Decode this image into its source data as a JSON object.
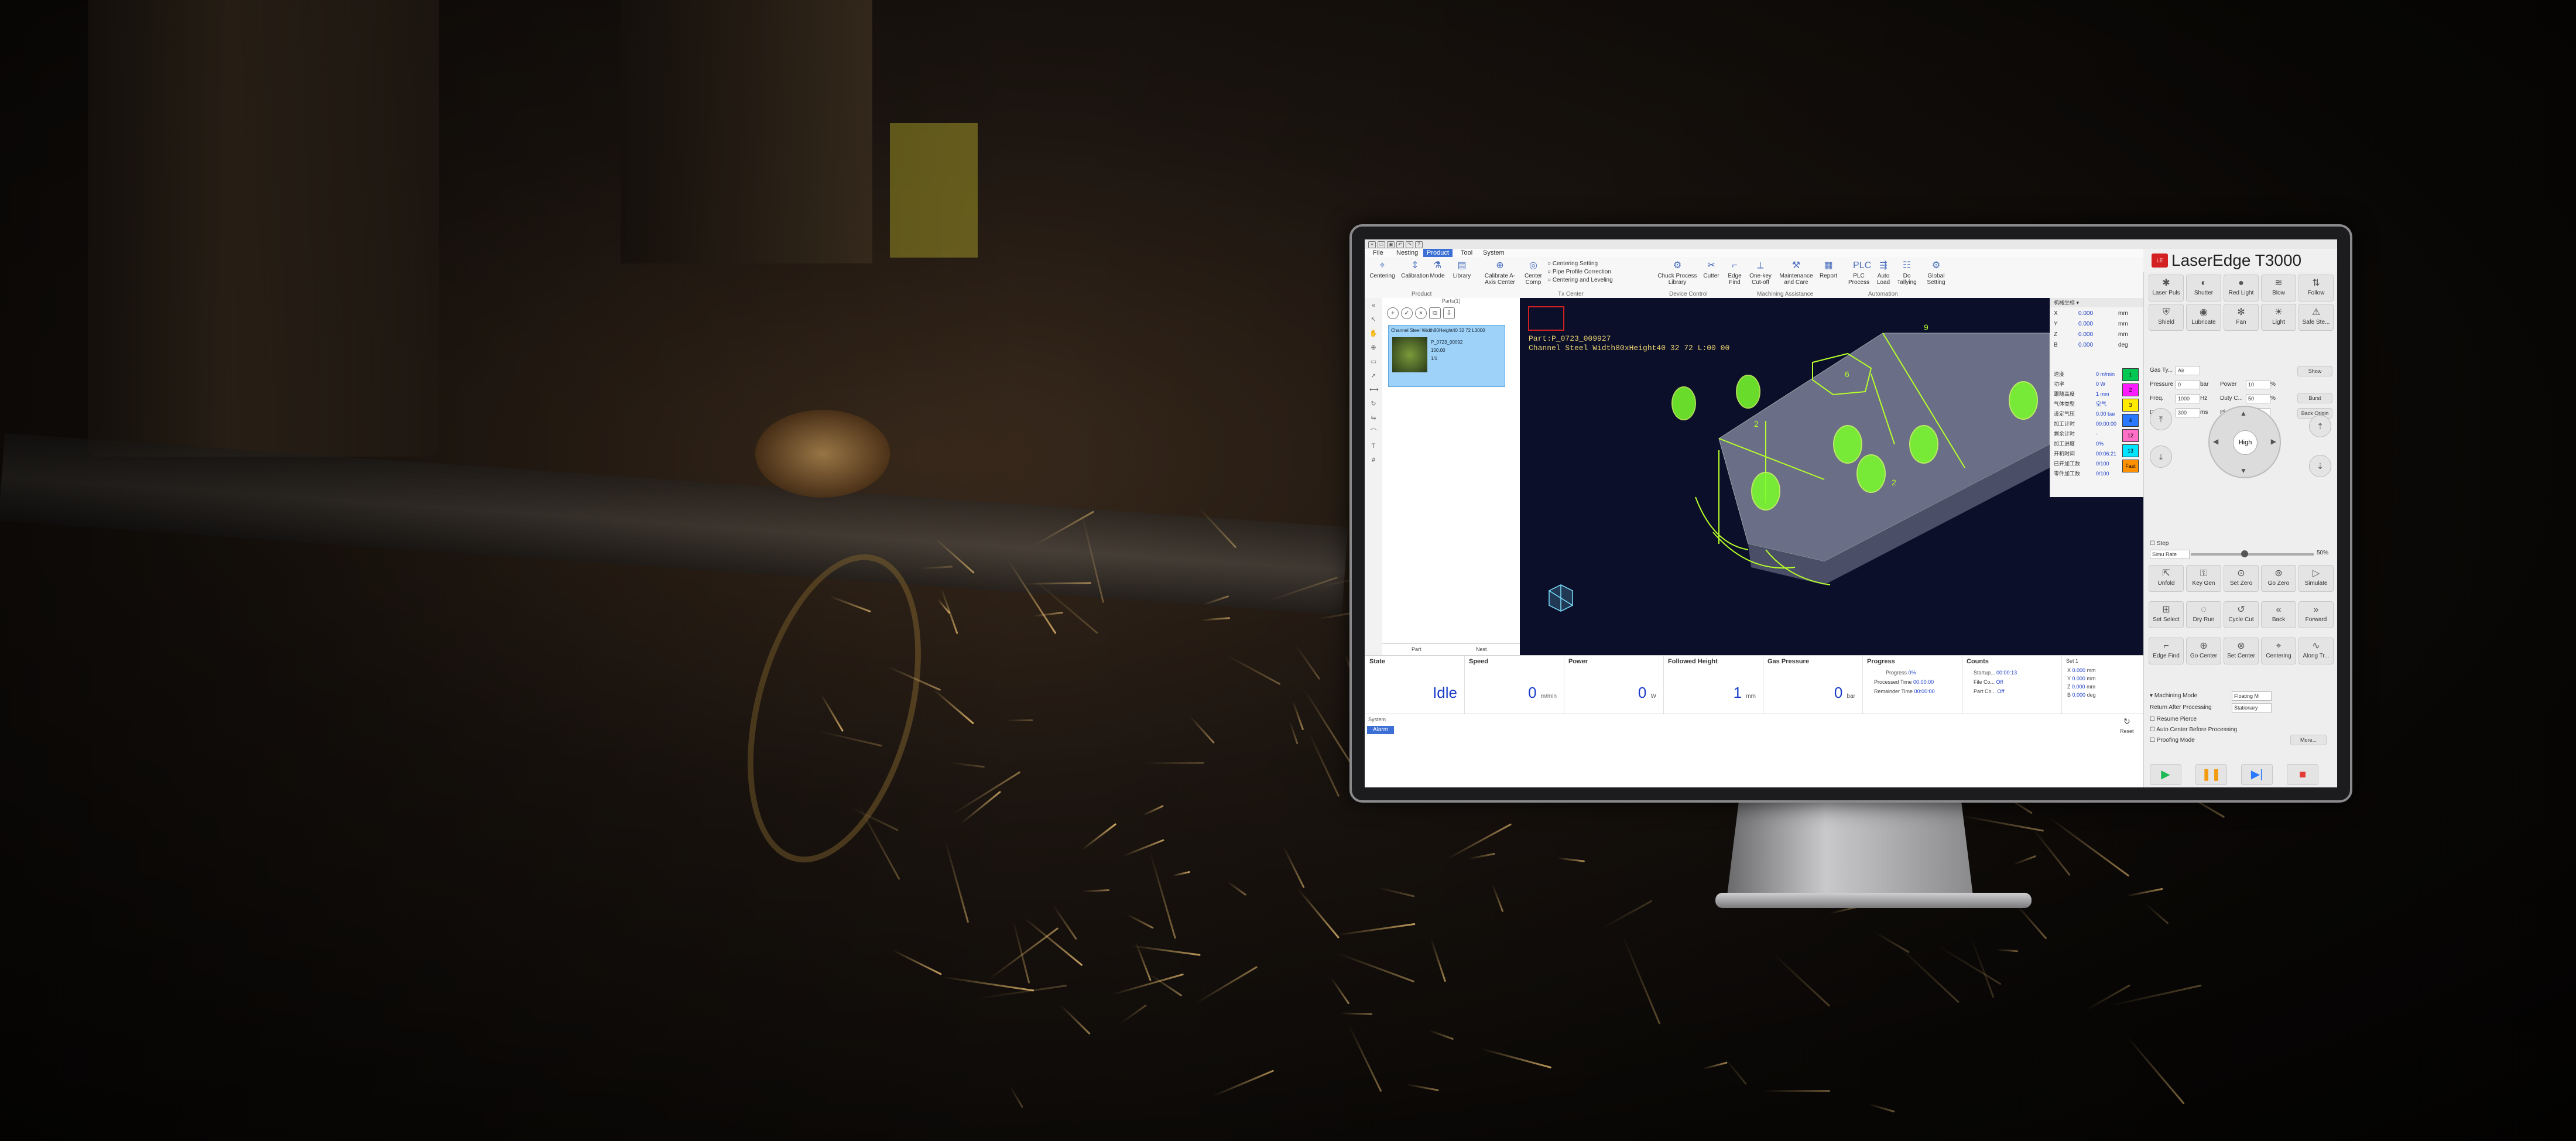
{
  "app": {
    "brand": "LaserEdge T3000",
    "logo_text": "LE"
  },
  "menu": {
    "tabs": [
      {
        "label": "File"
      },
      {
        "label": "Nesting"
      },
      {
        "label": "Product"
      },
      {
        "label": "Tool"
      },
      {
        "label": "System"
      }
    ],
    "active": "Product"
  },
  "ribbon": {
    "buttons": [
      {
        "label": "Centering",
        "icon": "crosshair-icon"
      },
      {
        "label": "Calibration",
        "icon": "calibration-icon"
      },
      {
        "label": "Mode",
        "icon": "mode-icon"
      },
      {
        "label": "Library",
        "icon": "library-icon"
      },
      {
        "label": "Calibrate A-Axis Center",
        "icon": "calibrate-icon"
      },
      {
        "label": "Center Comp",
        "icon": "center-comp-icon"
      },
      {
        "label": "Chuck Process Library",
        "icon": "chuck-icon"
      },
      {
        "label": "Cutter",
        "icon": "cutter-icon"
      },
      {
        "label": "Edge Find",
        "icon": "edge-find-icon"
      },
      {
        "label": "One-key Cut-off",
        "icon": "cutoff-icon"
      },
      {
        "label": "Maintenance and Care",
        "icon": "maintenance-icon"
      },
      {
        "label": "Report",
        "icon": "report-icon"
      },
      {
        "label": "PLC Process",
        "icon": "plc-icon"
      },
      {
        "label": "Auto Load",
        "icon": "auto-load-icon"
      },
      {
        "label": "Do Tallying",
        "icon": "tally-icon"
      },
      {
        "label": "Global Setting",
        "icon": "gear-icon"
      }
    ],
    "small_items": [
      "Centering Setting",
      "Pipe Profile Correction",
      "Centering and Leveling"
    ],
    "groups": [
      "Product",
      "Tx Center",
      "Device Control",
      "Machining Assistance",
      "Automation"
    ]
  },
  "parts_panel": {
    "title": "Parts(1)",
    "card_name": "Channel Steel Width80Height40 32 72 L3000",
    "card_lines": [
      "P_0723_00092",
      "100.00",
      "1/1"
    ],
    "footer_left": "Part",
    "footer_right": "Nest"
  },
  "canvas": {
    "part_line": "Part:P_0723_009927",
    "desc_line": "Channel Steel Width80xHeight40 32 72 L:00 00",
    "labels": [
      "2",
      "6",
      "9",
      "2"
    ]
  },
  "coords": {
    "header": "机械坐标",
    "rows": [
      {
        "axis": "X",
        "value": "0.000",
        "unit": "mm"
      },
      {
        "axis": "Y",
        "value": "0.000",
        "unit": "mm"
      },
      {
        "axis": "Z",
        "value": "0.000",
        "unit": "mm"
      },
      {
        "axis": "B",
        "value": "0.000",
        "unit": "deg"
      }
    ],
    "params": [
      {
        "label": "速度",
        "value": "0 m/min"
      },
      {
        "label": "功率",
        "value": "0 W"
      },
      {
        "label": "跟随高度",
        "value": "1 mm"
      },
      {
        "label": "气体类型",
        "value": "空气"
      },
      {
        "label": "设定气压",
        "value": "0.00 bar"
      },
      {
        "label": "加工计时",
        "value": "00:00:00"
      },
      {
        "label": "剩余计时",
        "value": "-"
      },
      {
        "label": "加工进度",
        "value": "0%"
      },
      {
        "label": "开机时间",
        "value": "00:06:21"
      },
      {
        "label": "已开加工数",
        "value": "0/100"
      },
      {
        "label": "零件加工数",
        "value": "0/100"
      }
    ]
  },
  "layers": [
    {
      "label": "1",
      "color": "#00c853"
    },
    {
      "label": "2",
      "color": "#ff1cff"
    },
    {
      "label": "3",
      "color": "#ffea00"
    },
    {
      "label": "4",
      "color": "#2979ff"
    },
    {
      "label": "12",
      "color": "#ff6ec7"
    },
    {
      "label": "13",
      "color": "#00e5ff"
    },
    {
      "label": "Fast",
      "color": "#ff9100"
    }
  ],
  "status": {
    "state_label": "State",
    "state_value": "Idle",
    "speed_label": "Speed",
    "speed_value": "0",
    "speed_unit": "m/min",
    "power_label": "Power",
    "power_value": "0",
    "power_unit": "W",
    "follow_label": "Followed Height",
    "follow_value": "1",
    "follow_unit": "mm",
    "gas_label": "Gas Pressure",
    "gas_value": "0",
    "gas_unit": "bar",
    "progress_label": "Progress",
    "progress_rows": [
      {
        "k": "Progress",
        "v": "0%"
      },
      {
        "k": "Processed Time",
        "v": "00:00:00"
      },
      {
        "k": "Remainder Time",
        "v": "00:00:00"
      }
    ],
    "counts_label": "Counts",
    "counts_rows": [
      {
        "k": "Startup...",
        "v": "00:00:13"
      },
      {
        "k": "File Co...",
        "v": "Off"
      },
      {
        "k": "Part Co...",
        "v": "Off"
      }
    ],
    "axes_label": "Set 1",
    "axes_rows": [
      {
        "axis": "X",
        "value": "0.000",
        "unit": "mm"
      },
      {
        "axis": "Y",
        "value": "0.000",
        "unit": "mm"
      },
      {
        "axis": "Z",
        "value": "0.000",
        "unit": "mm"
      },
      {
        "axis": "B",
        "value": "0.000",
        "unit": "deg"
      }
    ],
    "reset_label": "Reset"
  },
  "syslog": {
    "tab_system": "System",
    "tab_alarm": "Alarm"
  },
  "right_panel": {
    "top_buttons": [
      "Laser Puls",
      "Shutter",
      "Red Light",
      "Blow",
      "Follow",
      "Shield",
      "Lubricate",
      "Fan",
      "Light",
      "Safe Ste..."
    ],
    "fields": [
      {
        "label": "Gas Ty...",
        "value": "Air"
      },
      {
        "label": "Pressure",
        "value": "0",
        "unit": "bar"
      },
      {
        "label": "Power",
        "value": "10",
        "unit": "%"
      },
      {
        "label": "Freq.",
        "value": "1000",
        "unit": "Hz"
      },
      {
        "label": "Duty C...",
        "value": "50",
        "unit": "%"
      },
      {
        "label": "Delay",
        "value": "300",
        "unit": "ms"
      },
      {
        "label": "Pierce",
        "value": "",
        "unit": ""
      }
    ],
    "side_buttons": [
      "Show",
      "Burst",
      "Back Origin"
    ],
    "dpad_center": "High",
    "step_label": "Step",
    "step_mode": "Simu Rate",
    "step_percent": "50%",
    "grid_buttons": [
      "Unfold",
      "Key Gen",
      "Set Zero",
      "Go Zero",
      "Simulate",
      "Set Select",
      "Dry Run",
      "Cycle Cut",
      "Back",
      "Forward",
      "Edge Find",
      "Go Center",
      "Set Center",
      "Centering",
      "Along Tr..."
    ],
    "machining_mode_label": "Machining Mode",
    "machining_mode_value": "Floating M",
    "return_label": "Return After Processing",
    "return_value": "Stationary",
    "options": [
      "Resume Pierce",
      "Auto Center Before Processing",
      "Proofing Mode"
    ],
    "more_label": "More..."
  }
}
